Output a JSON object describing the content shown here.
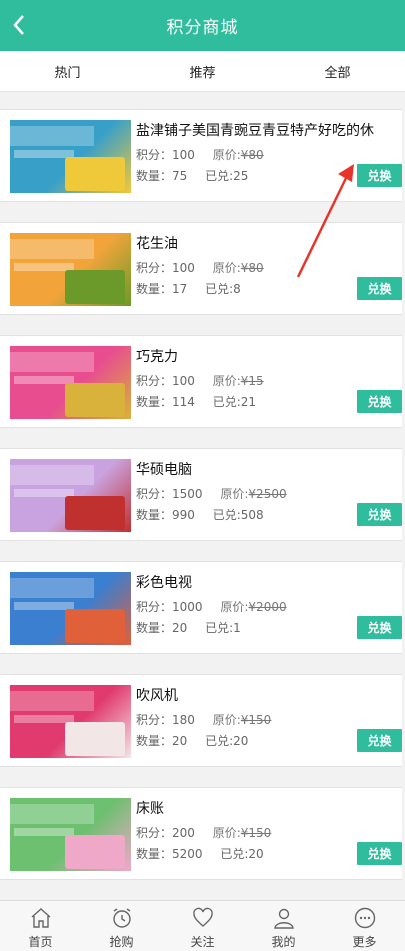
{
  "header": {
    "title": "积分商城",
    "back_icon": "chevron-left-icon"
  },
  "tabs": [
    {
      "label": "热门"
    },
    {
      "label": "推荐"
    },
    {
      "label": "全部"
    }
  ],
  "products": [
    {
      "name": "盐津铺子美国青豌豆青豆特产好吃的休",
      "points_text": "积分：100",
      "orig_label": "原价:",
      "orig_price": "¥80",
      "qty_text": "数量：75",
      "done_text": "已兑:25",
      "button": "兑换",
      "colors": [
        "#38a0c8",
        "#f0c93a"
      ]
    },
    {
      "name": "花生油",
      "points_text": "积分：100",
      "orig_label": "原价:",
      "orig_price": "¥80",
      "qty_text": "数量：17",
      "done_text": "已兑:8",
      "button": "兑换",
      "colors": [
        "#f2a43a",
        "#6b9a2a"
      ]
    },
    {
      "name": "巧克力",
      "points_text": "积分：100",
      "orig_label": "原价:",
      "orig_price": "¥15",
      "qty_text": "数量：114",
      "done_text": "已兑:21",
      "button": "兑换",
      "colors": [
        "#e84d8f",
        "#d8b23a"
      ]
    },
    {
      "name": "华硕电脑",
      "points_text": "积分：1500",
      "orig_label": "原价:",
      "orig_price": "¥2500",
      "qty_text": "数量：990",
      "done_text": "已兑:508",
      "button": "兑换",
      "colors": [
        "#c9a3e0",
        "#c0302f"
      ]
    },
    {
      "name": "彩色电视",
      "points_text": "积分：1000",
      "orig_label": "原价:",
      "orig_price": "¥2000",
      "qty_text": "数量：20",
      "done_text": "已兑:1",
      "button": "兑换",
      "colors": [
        "#3a7fd0",
        "#e0603a"
      ]
    },
    {
      "name": "吹风机",
      "points_text": "积分：180",
      "orig_label": "原价:",
      "orig_price": "¥150",
      "qty_text": "数量：20",
      "done_text": "已兑:20",
      "button": "兑换",
      "colors": [
        "#e03a6e",
        "#f3e6e6"
      ]
    },
    {
      "name": "床账",
      "points_text": "积分：200",
      "orig_label": "原价:",
      "orig_price": "¥150",
      "qty_text": "数量：5200",
      "done_text": "已兑:20",
      "button": "兑换",
      "colors": [
        "#6cc070",
        "#f0a8c8"
      ]
    }
  ],
  "tabbar": [
    {
      "label": "首页",
      "icon": "home-icon"
    },
    {
      "label": "抢购",
      "icon": "alarm-clock-icon"
    },
    {
      "label": "关注",
      "icon": "heart-icon"
    },
    {
      "label": "我的",
      "icon": "user-icon"
    },
    {
      "label": "更多",
      "icon": "more-icon"
    }
  ],
  "theme": {
    "accent": "#2fbd9d",
    "annotation": "#e8352b"
  }
}
